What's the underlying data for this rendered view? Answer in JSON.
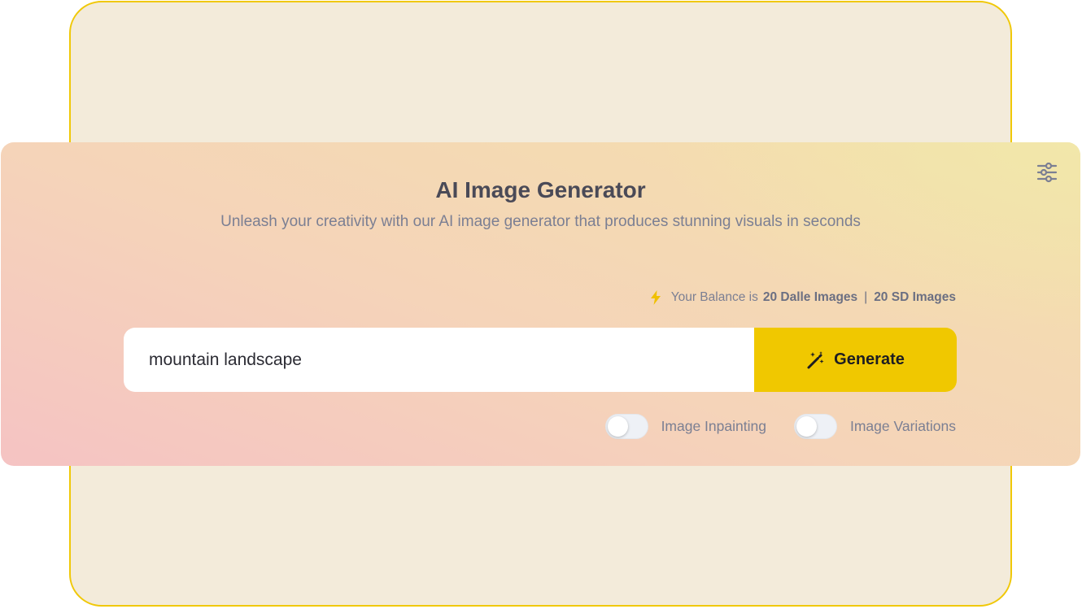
{
  "header": {
    "title": "AI Image Generator",
    "subtitle": "Unleash your creativity with our AI image generator that produces stunning visuals in seconds"
  },
  "settings": {
    "icon": "sliders-icon"
  },
  "balance": {
    "icon": "bolt-icon",
    "prefix": "Your Balance is",
    "dalle": "20 Dalle Images",
    "separator": "|",
    "sd": "20 SD Images"
  },
  "prompt": {
    "value": "mountain landscape",
    "placeholder": ""
  },
  "generate": {
    "label": "Generate",
    "icon": "magic-wand-icon"
  },
  "toggles": [
    {
      "label": "Image Inpainting",
      "on": false
    },
    {
      "label": "Image Variations",
      "on": false
    }
  ],
  "colors": {
    "accent": "#f0c800",
    "frame_border": "#f0c808",
    "frame_bg": "#f3ebda",
    "title": "#4a4a57",
    "muted": "#7b7f93"
  }
}
